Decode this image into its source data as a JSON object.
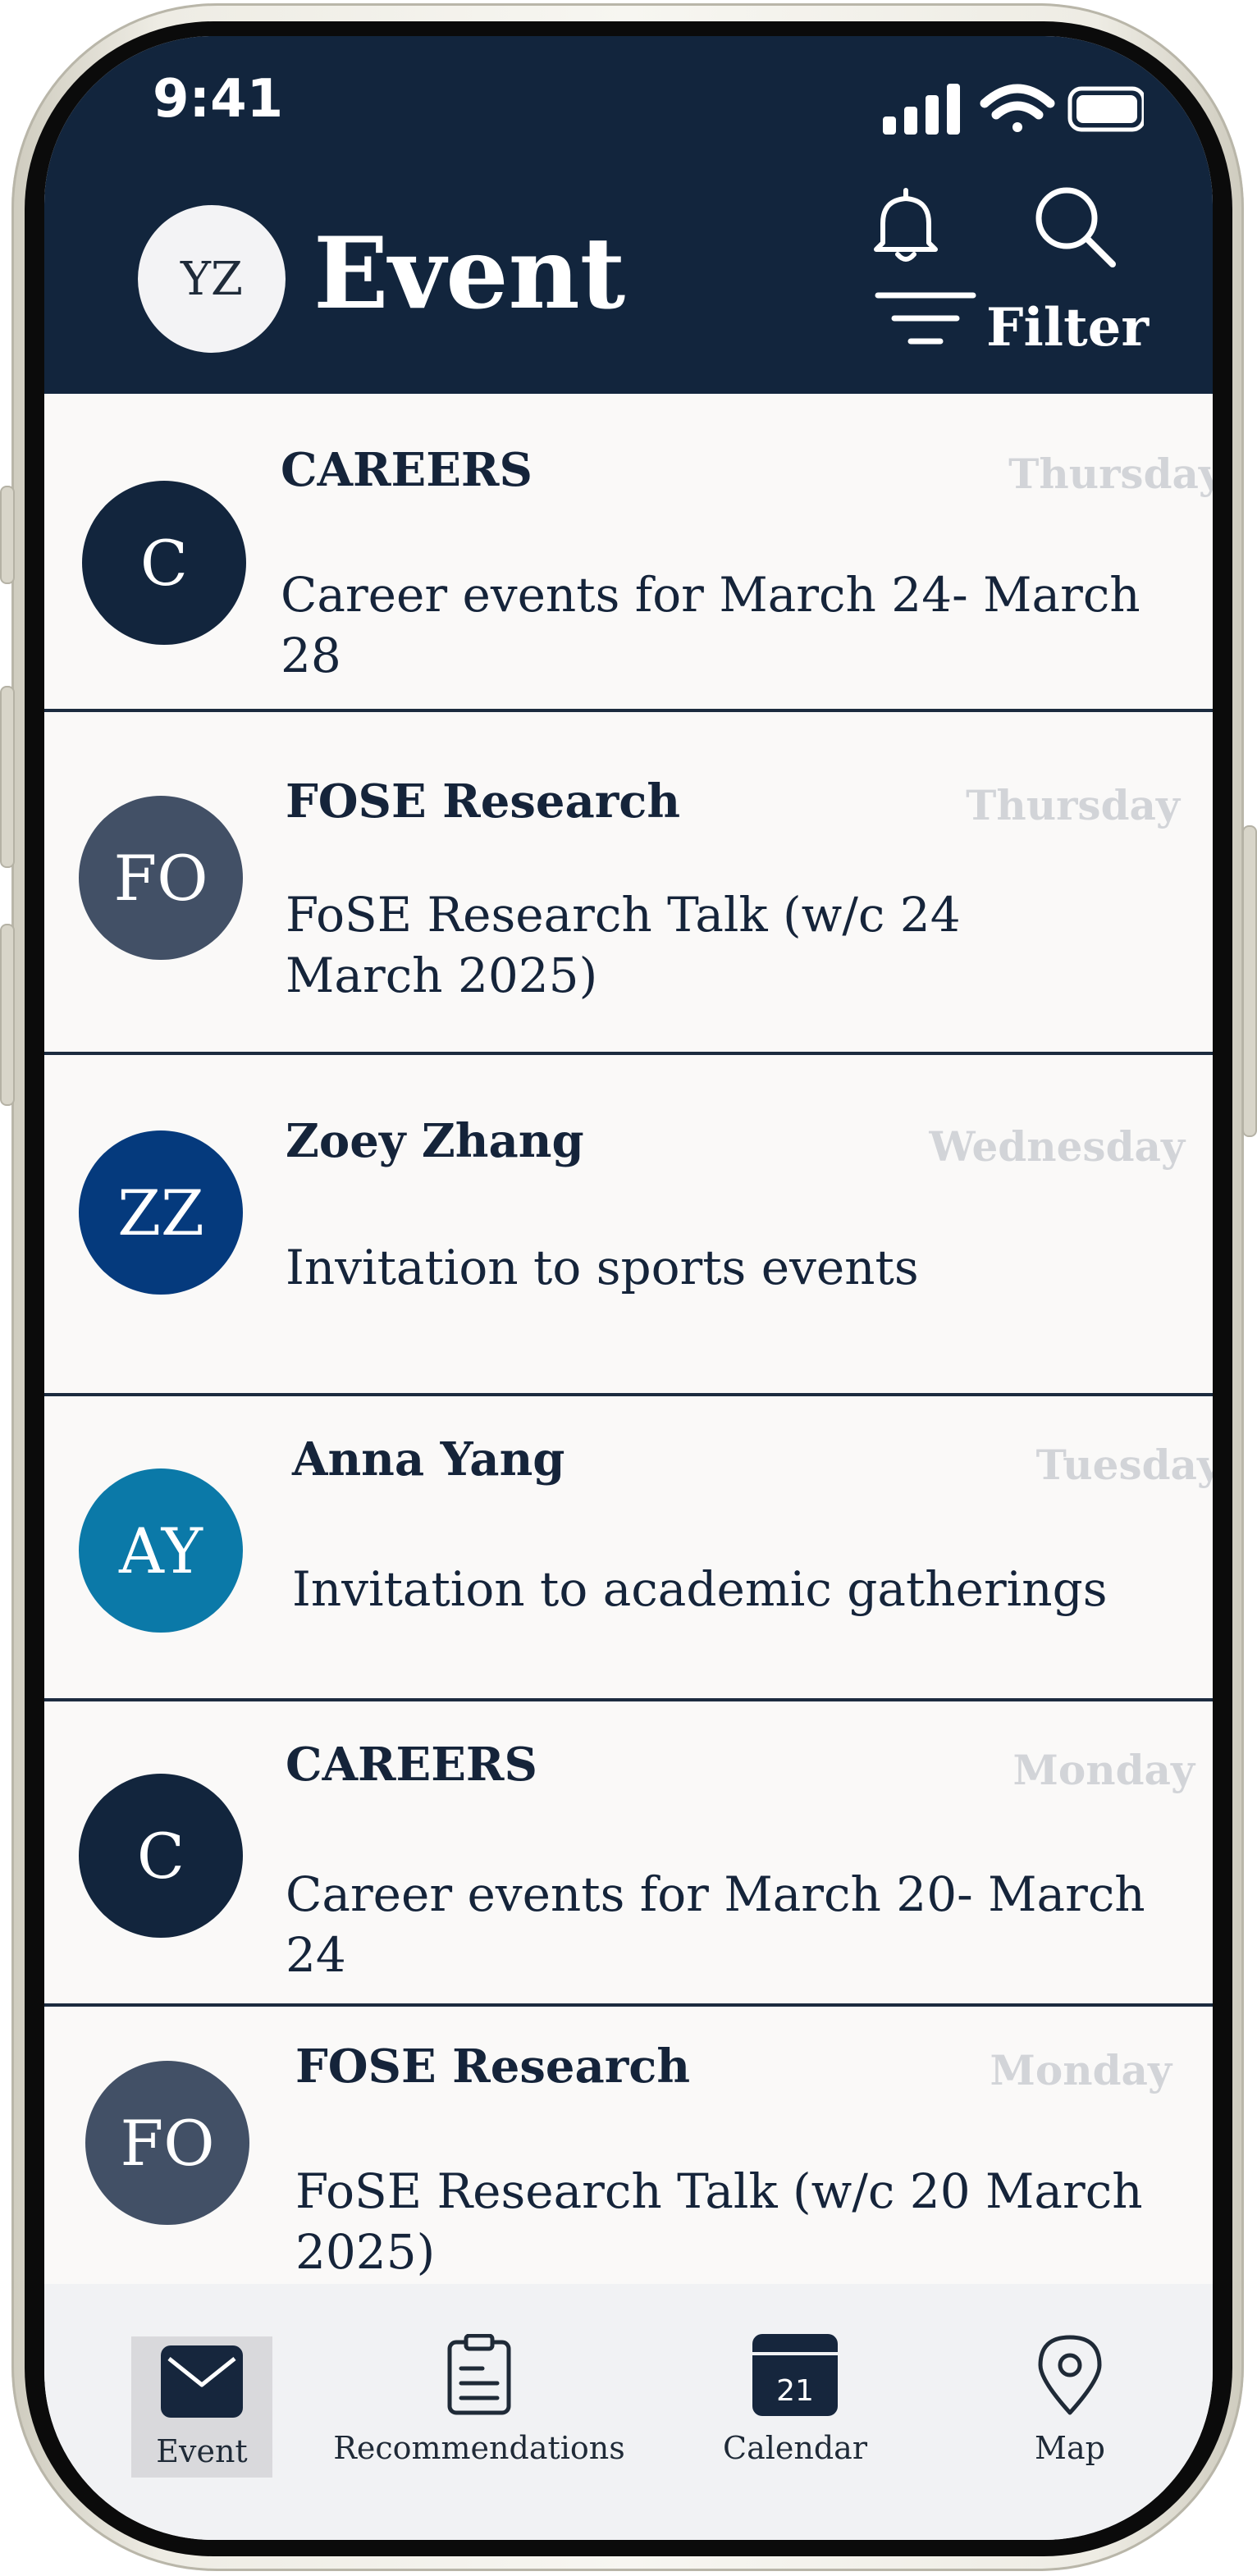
{
  "status_bar": {
    "time": "9:41"
  },
  "header": {
    "avatar_initials": "YZ",
    "title": "Event",
    "filter_label": "Filter"
  },
  "events": [
    {
      "initials": "C",
      "avatar_color": "#12253d",
      "sender": "CAREERS",
      "day": "Thursday",
      "title": "Career events for March 24- March 28"
    },
    {
      "initials": "FO",
      "avatar_color": "#425066",
      "sender": "FOSE Research",
      "day": "Thursday",
      "title": "FoSE Research Talk (w/c 24 March 2025)"
    },
    {
      "initials": "ZZ",
      "avatar_color": "#053a7d",
      "sender": "Zoey Zhang",
      "day": "Wednesday",
      "title": "Invitation to sports events"
    },
    {
      "initials": "AY",
      "avatar_color": "#0b79a8",
      "sender": "Anna Yang",
      "day": "Tuesday",
      "title": "Invitation to academic gatherings"
    },
    {
      "initials": "C",
      "avatar_color": "#12253d",
      "sender": "CAREERS",
      "day": "Monday",
      "title": "Career events for March 20- March 24"
    },
    {
      "initials": "FO",
      "avatar_color": "#425066",
      "sender": "FOSE Research",
      "day": "Monday",
      "title": "FoSE Research Talk (w/c 20 March 2025)"
    }
  ],
  "tabbar": {
    "items": [
      {
        "label": "Event",
        "icon": "mail-icon",
        "active": true
      },
      {
        "label": "Recommendations",
        "icon": "clipboard-icon",
        "active": false
      },
      {
        "label": "Calendar",
        "icon": "calendar-icon",
        "active": false,
        "icon_text": "21"
      },
      {
        "label": "Map",
        "icon": "map-pin-icon",
        "active": false
      }
    ]
  },
  "colors": {
    "header_bg": "#12253d",
    "list_bg": "#faf9f8",
    "divider": "#1c2b3f",
    "day_text": "#d2d4d8",
    "tabbar_bg": "#f1f2f4"
  }
}
